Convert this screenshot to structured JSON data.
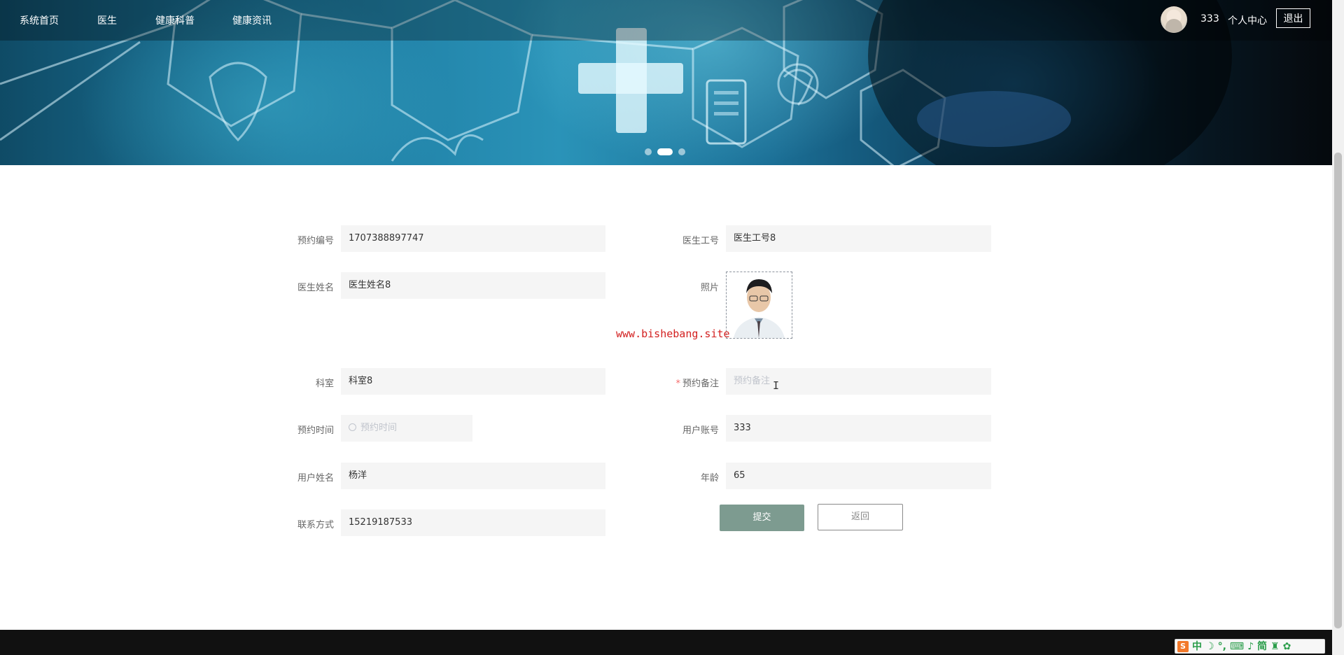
{
  "nav": {
    "items": [
      "系统首页",
      "医生",
      "健康科普",
      "健康资讯"
    ],
    "user_name": "333",
    "user_center": "个人中心",
    "logout": "退出"
  },
  "banner": {
    "carousel_pages": 3,
    "active_page": 2
  },
  "form": {
    "booking_no_label": "预约编号",
    "booking_no_value": "1707388897747",
    "doctor_id_label": "医生工号",
    "doctor_id_value": "医生工号8",
    "doctor_name_label": "医生姓名",
    "doctor_name_value": "医生姓名8",
    "photo_label": "照片",
    "department_label": "科室",
    "department_value": "科室8",
    "remark_label": "预约备注",
    "remark_placeholder": "预约备注",
    "time_label": "预约时间",
    "time_placeholder": "预约时间",
    "account_label": "用户账号",
    "account_value": "333",
    "user_name_label": "用户姓名",
    "user_name_value": "杨洋",
    "age_label": "年龄",
    "age_value": "65",
    "phone_label": "联系方式",
    "phone_value": "15219187533",
    "submit": "提交",
    "back": "返回"
  },
  "watermark": "www.bishebang.site",
  "ime": {
    "logo": "S",
    "mode": "中",
    "simplified": "简"
  },
  "colors": {
    "submit_bg": "#7d9b90",
    "required_mark": "#f56c6c",
    "watermark": "#d32020"
  }
}
